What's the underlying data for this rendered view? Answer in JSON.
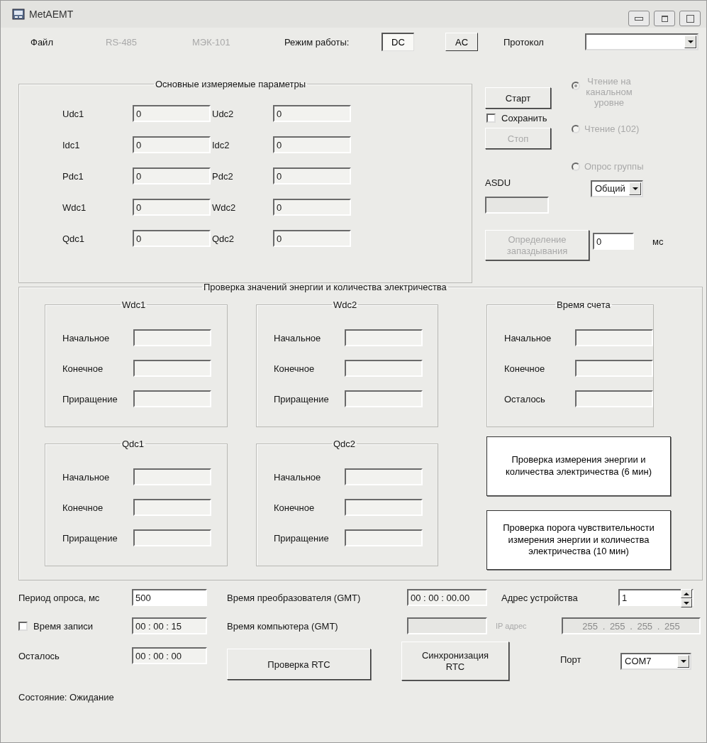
{
  "window": {
    "title": "MetAEMT"
  },
  "menu": [
    {
      "label": "Файл",
      "disabled": false
    },
    {
      "label": "RS-485",
      "disabled": true
    },
    {
      "label": "МЭК-101",
      "disabled": true
    }
  ],
  "mode": {
    "label": "Режим работы:",
    "options": [
      {
        "label": "DC",
        "selected": true
      },
      {
        "label": "AC",
        "selected": false
      }
    ]
  },
  "protocol": {
    "label": "Протокол"
  },
  "main_params": {
    "title": "Основные измеряемые параметры",
    "fields": [
      {
        "label": "Udc1",
        "value": "0"
      },
      {
        "label": "Udc2",
        "value": "0"
      },
      {
        "label": "Idc1",
        "value": "0"
      },
      {
        "label": "Idc2",
        "value": "0"
      },
      {
        "label": "Pdc1",
        "value": "0"
      },
      {
        "label": "Pdc2",
        "value": "0"
      },
      {
        "label": "Wdc1",
        "value": "0"
      },
      {
        "label": "Wdc2",
        "value": "0"
      },
      {
        "label": "Qdc1",
        "value": "0"
      },
      {
        "label": "Qdc2",
        "value": "0"
      }
    ]
  },
  "controls": {
    "start": {
      "label": "Старт",
      "disabled": false
    },
    "save": {
      "label": "Сохранить",
      "checked": false
    },
    "stop": {
      "label": "Стоп",
      "disabled": true
    },
    "asdu": {
      "label": "ASDU",
      "disabled": true
    },
    "delay_button": {
      "label": "Определение запаздывания",
      "disabled": true
    }
  },
  "read_modes": [
    {
      "label": "Чтение на канальном уровне",
      "selected": true,
      "disabled": true
    },
    {
      "label": "Чтение (102)",
      "selected": false,
      "disabled": true
    },
    {
      "label": "Опрос группы",
      "selected": false,
      "disabled": true
    }
  ],
  "group_select": {
    "value": "Общий"
  },
  "delay": {
    "value": "0",
    "unit": "мс"
  },
  "energy_check": {
    "title": "Проверка значений энергии и количества электричества",
    "groups": [
      {
        "title": "Wdc1",
        "rows": [
          "Начальное",
          "Конечное",
          "Приращение"
        ]
      },
      {
        "title": "Wdc2",
        "rows": [
          "Начальное",
          "Конечное",
          "Приращение"
        ]
      },
      {
        "title": "Время счета",
        "rows": [
          "Начальное",
          "Конечное",
          "Осталось"
        ]
      },
      {
        "title": "Qdc1",
        "rows": [
          "Начальное",
          "Конечное",
          "Приращение"
        ]
      },
      {
        "title": "Qdc2",
        "rows": [
          "Начальное",
          "Конечное",
          "Приращение"
        ]
      }
    ],
    "buttons": [
      "Проверка измерения энергии и количества электричества (6 мин)",
      "Проверка порога чувствительности измерения энергии и количества электричества (10 мин)"
    ]
  },
  "bottom": {
    "poll_period": {
      "label": "Период опроса, мс",
      "value": "500"
    },
    "record_time": {
      "label": "Время записи",
      "checked": false,
      "value": "00 : 00 : 15"
    },
    "remaining": {
      "label": "Осталось",
      "value": "00 : 00 : 00"
    },
    "converter_time": {
      "label": "Время преобразователя (GMT)",
      "value": "00 : 00 : 00.00"
    },
    "computer_time": {
      "label": "Время компьютера (GMT)",
      "disabled": true
    },
    "rtc_check": "Проверка RTC",
    "rtc_sync": "Синхронизация RTC",
    "device_address": {
      "label": "Адрес устройства",
      "value": "1"
    },
    "ip_address": {
      "label": "IP адрес",
      "value": "255 . 255 . 255 . 255",
      "disabled": true
    },
    "port": {
      "label": "Порт",
      "value": "COM7"
    }
  },
  "status": "Состояние:  Ожидание"
}
